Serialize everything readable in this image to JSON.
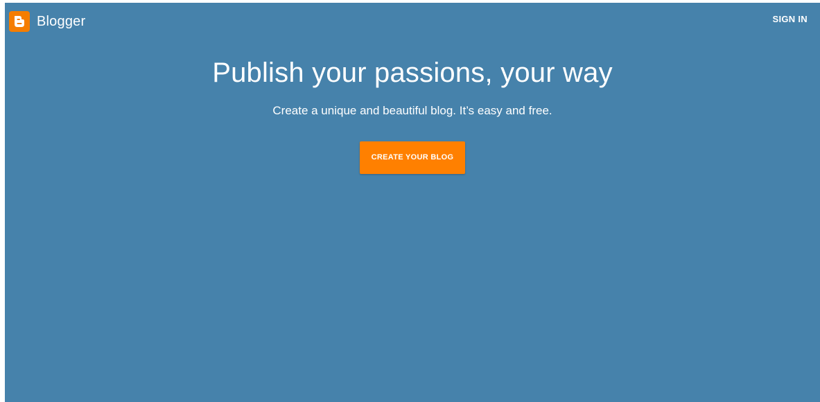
{
  "header": {
    "brand_name": "Blogger",
    "logo_icon": "blogger-logo-icon",
    "signin_label": "SIGN IN"
  },
  "hero": {
    "headline": "Publish your passions, your way",
    "subline": "Create a unique and beautiful blog. It’s easy and free.",
    "cta_label": "CREATE YOUR BLOG"
  },
  "colors": {
    "background": "#4682ab",
    "logo": "#f57d00",
    "cta": "#ff8000",
    "text": "#ffffff"
  }
}
